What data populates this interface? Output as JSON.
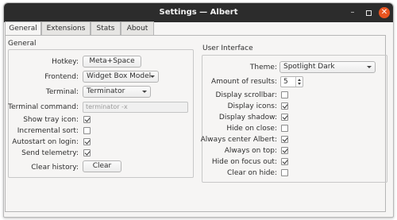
{
  "window": {
    "title": "Settings — Albert",
    "minimize_glyph": "–",
    "close_glyph": "✕"
  },
  "tabs": [
    {
      "label": "General",
      "active": true
    },
    {
      "label": "Extensions",
      "active": false
    },
    {
      "label": "Stats",
      "active": false
    },
    {
      "label": "About",
      "active": false
    }
  ],
  "general": {
    "title": "General",
    "hotkey": {
      "label": "Hotkey:",
      "value": "Meta+Space"
    },
    "frontend": {
      "label": "Frontend:",
      "value": "Widget Box Model"
    },
    "terminal": {
      "label": "Terminal:",
      "value": "Terminator"
    },
    "terminal_command": {
      "label": "Terminal command:",
      "value": "terminator -x"
    },
    "show_tray_icon": {
      "label": "Show tray icon:",
      "checked": true
    },
    "incremental_sort": {
      "label": "Incremental sort:",
      "checked": false
    },
    "autostart": {
      "label": "Autostart on login:",
      "checked": true
    },
    "send_telemetry": {
      "label": "Send telemetry:",
      "checked": true
    },
    "clear_history": {
      "label": "Clear history:",
      "button": "Clear"
    }
  },
  "ui": {
    "title": "User Interface",
    "theme": {
      "label": "Theme:",
      "value": "Spotlight Dark"
    },
    "amount_results": {
      "label": "Amount of results:",
      "value": "5"
    },
    "display_scrollbar": {
      "label": "Display scrollbar:",
      "checked": false
    },
    "display_icons": {
      "label": "Display icons:",
      "checked": true
    },
    "display_shadow": {
      "label": "Display shadow:",
      "checked": true
    },
    "hide_on_close": {
      "label": "Hide on close:",
      "checked": false
    },
    "always_center": {
      "label": "Always center Albert:",
      "checked": true
    },
    "always_on_top": {
      "label": "Always on top:",
      "checked": true
    },
    "hide_on_focus_out": {
      "label": "Hide on focus out:",
      "checked": true
    },
    "clear_on_hide": {
      "label": "Clear on hide:",
      "checked": false
    }
  },
  "colors": {
    "titlebar": "#2c2c2c",
    "close_button": "#e95420",
    "window_bg": "#f6f5f4"
  }
}
